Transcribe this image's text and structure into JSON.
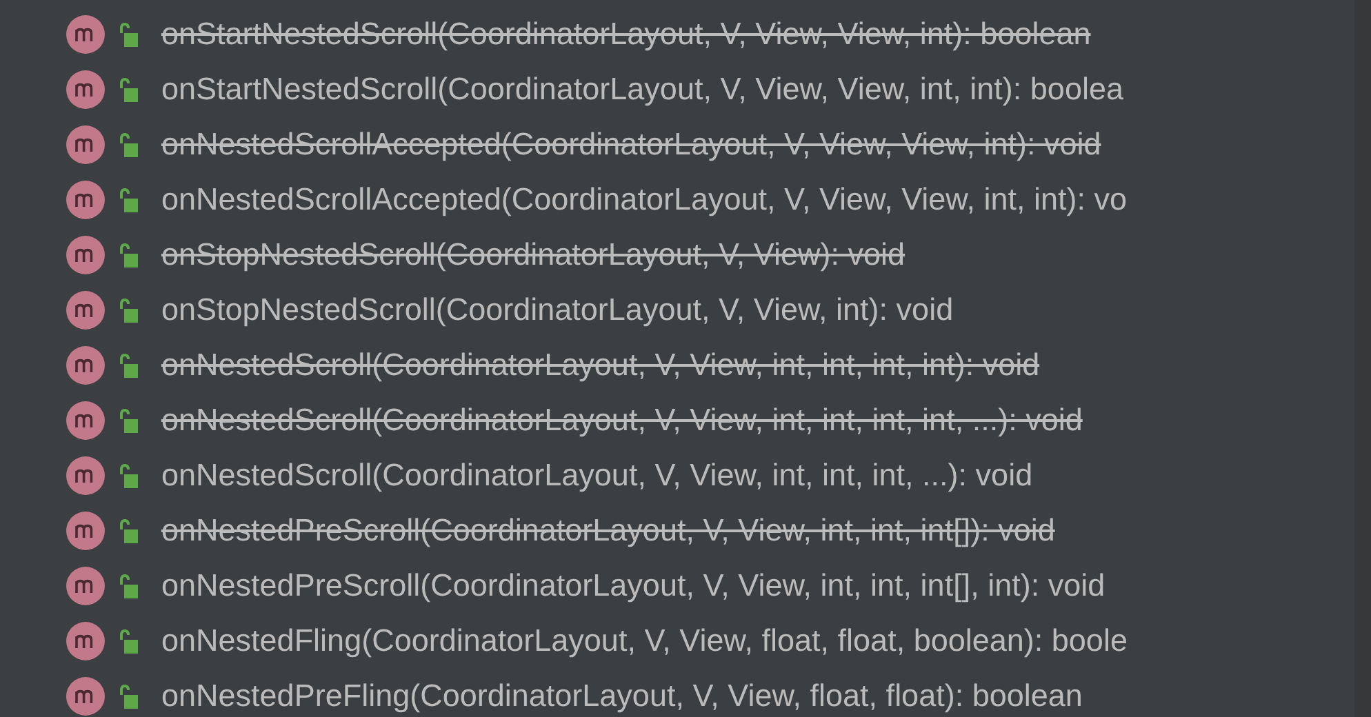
{
  "completion_items": [
    {
      "text": "onStartNestedScroll(CoordinatorLayout, V, View, View, int): boolean",
      "deprecated": true
    },
    {
      "text": "onStartNestedScroll(CoordinatorLayout, V, View, View, int, int): boolea",
      "deprecated": false
    },
    {
      "text": "onNestedScrollAccepted(CoordinatorLayout, V, View, View, int): void",
      "deprecated": true
    },
    {
      "text": "onNestedScrollAccepted(CoordinatorLayout, V, View, View, int, int): vo",
      "deprecated": false
    },
    {
      "text": "onStopNestedScroll(CoordinatorLayout, V, View): void",
      "deprecated": true
    },
    {
      "text": "onStopNestedScroll(CoordinatorLayout, V, View, int): void",
      "deprecated": false
    },
    {
      "text": "onNestedScroll(CoordinatorLayout, V, View, int, int, int, int): void",
      "deprecated": true
    },
    {
      "text": "onNestedScroll(CoordinatorLayout, V, View, int, int, int, int, ...): void",
      "deprecated": true
    },
    {
      "text": "onNestedScroll(CoordinatorLayout, V, View, int, int, int, ...): void",
      "deprecated": false
    },
    {
      "text": "onNestedPreScroll(CoordinatorLayout, V, View, int, int, int[]): void",
      "deprecated": true
    },
    {
      "text": "onNestedPreScroll(CoordinatorLayout, V, View, int, int, int[], int): void",
      "deprecated": false
    },
    {
      "text": "onNestedFling(CoordinatorLayout, V, View, float, float, boolean): boole",
      "deprecated": false
    },
    {
      "text": "onNestedPreFling(CoordinatorLayout, V, View, float, float): boolean",
      "deprecated": false
    }
  ]
}
